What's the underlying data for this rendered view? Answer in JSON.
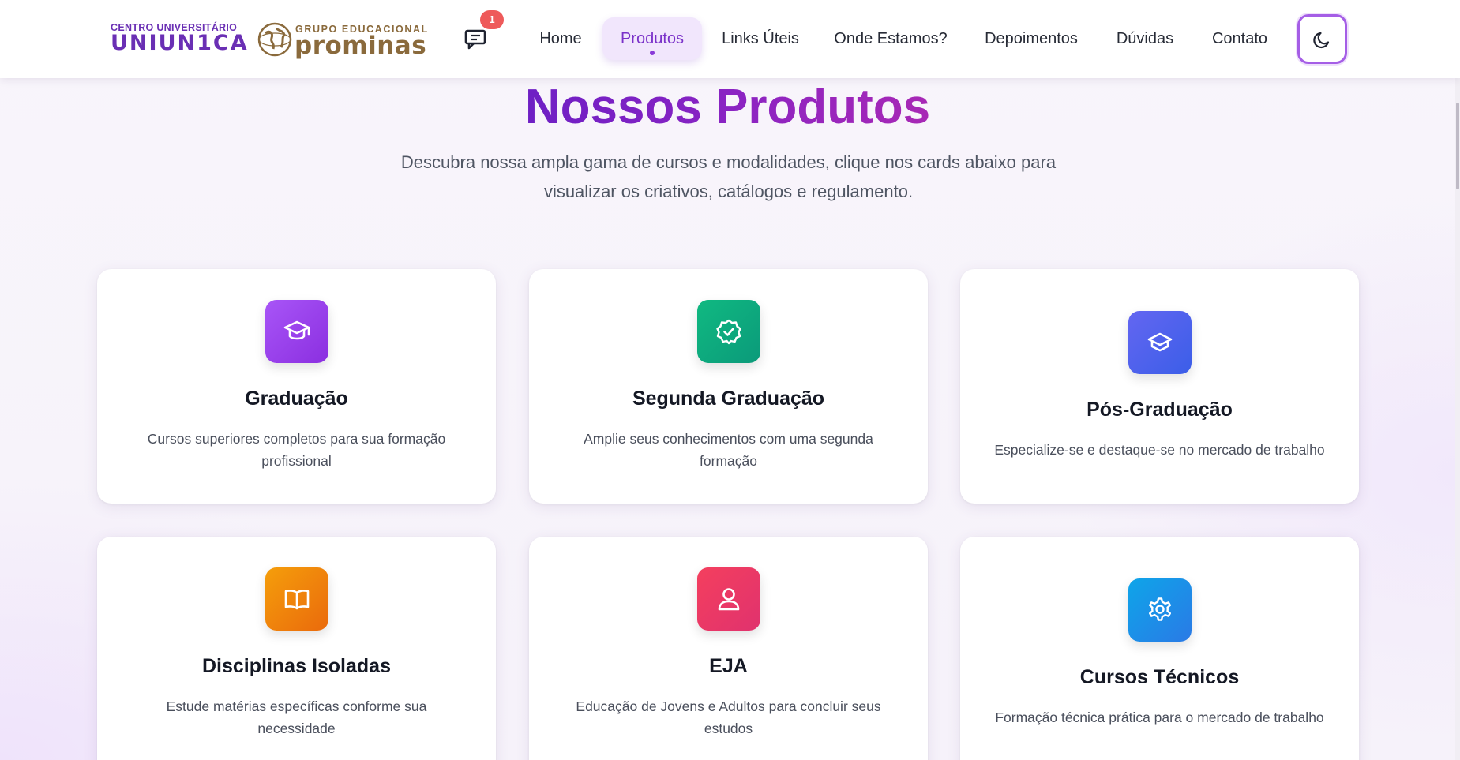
{
  "header": {
    "logo_unica": {
      "top_text": "CENTRO UNIVERSITÁRIO",
      "main_text": "UNIUN1CA"
    },
    "logo_prominas": {
      "top_text": "GRUPO EDUCACIONAL",
      "main_text": "prominas"
    },
    "messages_badge": "1",
    "nav": [
      {
        "label": "Home"
      },
      {
        "label": "Produtos"
      },
      {
        "label": "Links Úteis"
      },
      {
        "label": "Onde Estamos?"
      },
      {
        "label": "Depoimentos"
      },
      {
        "label": "Dúvidas"
      },
      {
        "label": "Contato"
      }
    ],
    "active_nav": "Produtos",
    "theme_toggle_icon": "moon-icon"
  },
  "hero": {
    "title": "Nossos Produtos",
    "subtitle_line1": "Descubra nossa ampla gama de cursos e modalidades, clique nos cards abaixo para",
    "subtitle_line2": "visualizar os criativos, catálogos e regulamento."
  },
  "products": [
    {
      "title": "Graduação",
      "desc_line1": "Cursos superiores completos para sua formação",
      "desc_line2": "profissional",
      "icon": "graduation-cap-icon",
      "color_from": "#a855f7",
      "color_to": "#8b2fe0"
    },
    {
      "title": "Segunda Graduação",
      "desc_line1": "Amplie seus conhecimentos com uma segunda",
      "desc_line2": "formação",
      "icon": "badge-check-icon",
      "color_from": "#10b981",
      "color_to": "#0b9a7a"
    },
    {
      "title": "Pós-Graduação",
      "desc_line1": "Especialize-se e destaque-se no mercado de trabalho",
      "desc_line2": "",
      "icon": "layers-icon",
      "color_from": "#6366f1",
      "color_to": "#3b5ee8"
    },
    {
      "title": "Disciplinas Isoladas",
      "desc_line1": "Estude matérias específicas conforme sua",
      "desc_line2": "necessidade",
      "icon": "book-open-icon",
      "color_from": "#f59e0b",
      "color_to": "#ea6a0c"
    },
    {
      "title": "EJA",
      "desc_line1": "Educação de Jovens e Adultos para concluir seus",
      "desc_line2": "estudos",
      "icon": "user-icon",
      "color_from": "#f43f5e",
      "color_to": "#e0326e"
    },
    {
      "title": "Cursos Técnicos",
      "desc_line1": "Formação técnica prática para o mercado de trabalho",
      "desc_line2": "",
      "icon": "gear-icon",
      "color_from": "#0ea5e9",
      "color_to": "#2a7ae6"
    }
  ]
}
